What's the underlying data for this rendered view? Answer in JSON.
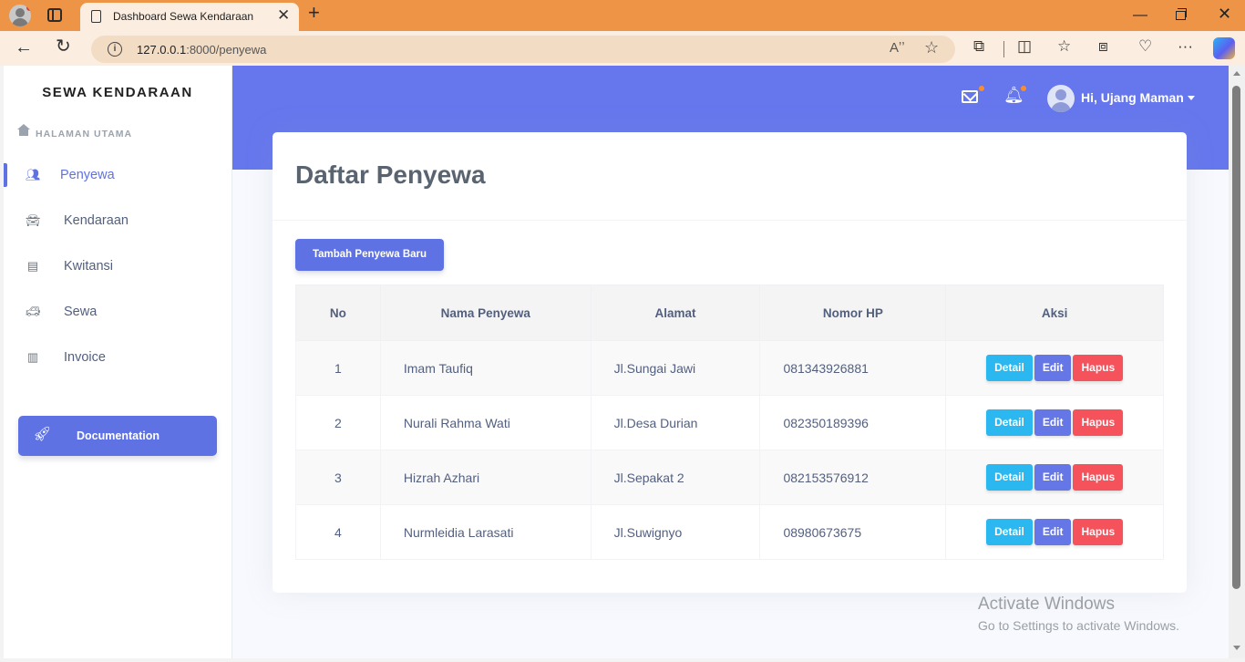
{
  "browser": {
    "tab_title": "Dashboard Sewa Kendaraan",
    "tab_close": "✕",
    "new_tab": "+",
    "url_host": "127.0.0.1",
    "url_path": ":8000/penyewa",
    "read_aloud": "Aʼʼ",
    "favorite": "☆"
  },
  "sidebar": {
    "brand": "SEWA KENDARAAN",
    "section": "HALAMAN UTAMA",
    "items": [
      {
        "label": "Penyewa",
        "icon": "users-icon",
        "active": true
      },
      {
        "label": "Kendaraan",
        "icon": "car-icon",
        "active": false
      },
      {
        "label": "Kwitansi",
        "icon": "receipt-icon",
        "active": false
      },
      {
        "label": "Sewa",
        "icon": "car-side-icon",
        "active": false
      },
      {
        "label": "Invoice",
        "icon": "invoice-icon",
        "active": false
      }
    ],
    "doc_button": "Documentation"
  },
  "header": {
    "user_greeting": "Hi, Ujang Maman",
    "accent": "#6677ee"
  },
  "main": {
    "title": "Daftar Penyewa",
    "add_button": "Tambah Penyewa Baru",
    "columns": [
      "No",
      "Nama Penyewa",
      "Alamat",
      "Nomor HP",
      "Aksi"
    ],
    "rows": [
      {
        "no": "1",
        "nama": "Imam Taufiq",
        "alamat": "Jl.Sungai Jawi",
        "hp": "081343926881"
      },
      {
        "no": "2",
        "nama": "Nurali Rahma Wati",
        "alamat": "Jl.Desa Durian",
        "hp": "082350189396"
      },
      {
        "no": "3",
        "nama": "Hizrah Azhari",
        "alamat": "Jl.Sepakat 2",
        "hp": "082153576912"
      },
      {
        "no": "4",
        "nama": "Nurmleidia Larasati",
        "alamat": "Jl.Suwignyo",
        "hp": "08980673675"
      }
    ],
    "actions": {
      "detail": "Detail",
      "edit": "Edit",
      "hapus": "Hapus"
    }
  },
  "watermark": {
    "line1": "Activate Windows",
    "line2": "Go to Settings to activate Windows."
  },
  "colors": {
    "primary": "#5e72e4",
    "info": "#2bb8f0",
    "danger": "#f5525c",
    "browser_orange": "#ed9446"
  }
}
